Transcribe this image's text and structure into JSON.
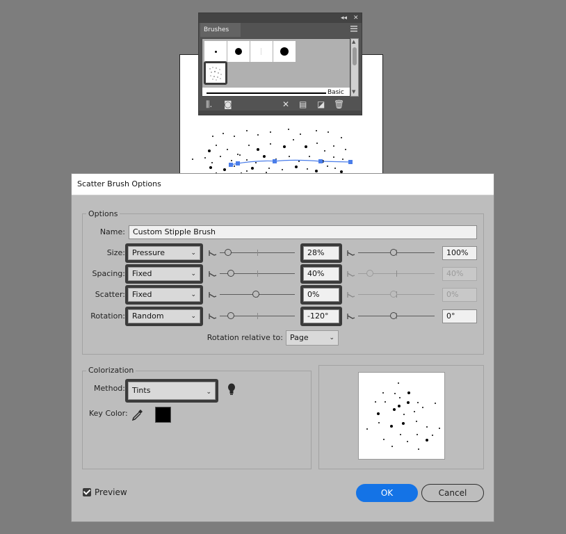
{
  "brushes_panel": {
    "title": "Brushes",
    "collapse_glyph": "◂◂",
    "close_glyph": "✕",
    "menu_icon": "hamburger-icon",
    "basic_label": "Basic",
    "footer_icons": [
      "brush-libraries-icon",
      "library-panel-icon",
      "remove-stroke-icon",
      "brush-options-icon",
      "new-brush-icon",
      "delete-brush-icon"
    ]
  },
  "dialog": {
    "title": "Scatter Brush Options",
    "options_group": "Options",
    "name_label": "Name:",
    "name_value": "Custom Stipple Brush",
    "rows": [
      {
        "label": "Size:",
        "mode": "Pressure",
        "min_value": "28%",
        "max_value": "100%",
        "max_disabled": false
      },
      {
        "label": "Spacing:",
        "mode": "Fixed",
        "min_value": "40%",
        "max_value": "40%",
        "max_disabled": true
      },
      {
        "label": "Scatter:",
        "mode": "Fixed",
        "min_value": "0%",
        "max_value": "0%",
        "max_disabled": true
      },
      {
        "label": "Rotation:",
        "mode": "Random",
        "min_value": "-120°",
        "max_value": "0°",
        "max_disabled": false
      }
    ],
    "rotation_relative_label": "Rotation relative to:",
    "rotation_relative_value": "Page",
    "colorization_group": "Colorization",
    "method_label": "Method:",
    "method_value": "Tints",
    "key_color_label": "Key Color:",
    "key_color": "#000000",
    "tips_icon": "lightbulb-icon",
    "eyedropper_icon": "eyedropper-icon",
    "preview_label": "Preview",
    "preview_checked": true,
    "ok_label": "OK",
    "cancel_label": "Cancel"
  },
  "colors": {
    "background": "#7d7d7d",
    "dialog_bg": "#bdbdbd",
    "accent": "#1473e6",
    "path_color": "#4a7de9"
  }
}
